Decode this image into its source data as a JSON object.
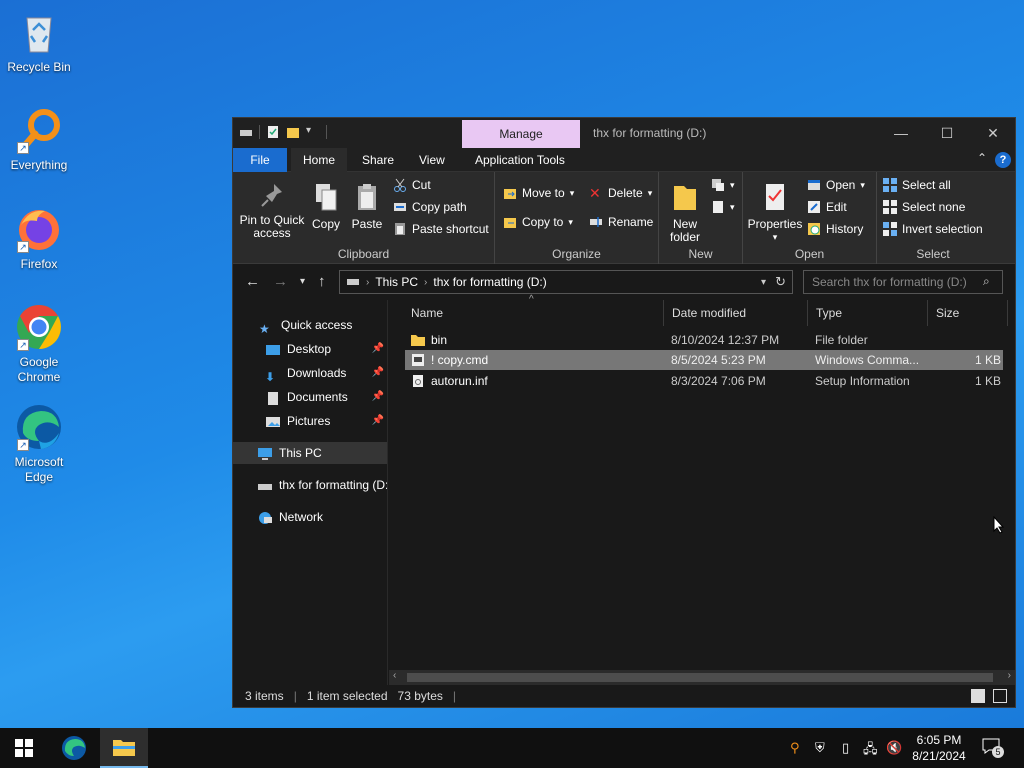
{
  "desktop": {
    "icons": [
      {
        "label": "Recycle Bin"
      },
      {
        "label": "Everything"
      },
      {
        "label": "Firefox"
      },
      {
        "label": "Google Chrome"
      },
      {
        "label": "Microsoft Edge"
      }
    ]
  },
  "window": {
    "manage_tab": "Manage",
    "title": "thx for formatting (D:)",
    "tabs": {
      "file": "File",
      "home": "Home",
      "share": "Share",
      "view": "View",
      "app_tools": "Application Tools"
    },
    "ribbon": {
      "clipboard": {
        "label": "Clipboard",
        "pin": "Pin to Quick access",
        "copy": "Copy",
        "paste": "Paste",
        "cut": "Cut",
        "copy_path": "Copy path",
        "paste_shortcut": "Paste shortcut"
      },
      "organize": {
        "label": "Organize",
        "move_to": "Move to",
        "copy_to": "Copy to",
        "delete": "Delete",
        "rename": "Rename"
      },
      "new": {
        "label": "New",
        "new_folder": "New folder"
      },
      "open": {
        "label": "Open",
        "properties": "Properties",
        "open": "Open",
        "edit": "Edit",
        "history": "History"
      },
      "select": {
        "label": "Select",
        "select_all": "Select all",
        "select_none": "Select none",
        "invert": "Invert selection"
      }
    },
    "address": {
      "crumb1": "This PC",
      "crumb2": "thx for formatting (D:)"
    },
    "search_placeholder": "Search thx for formatting (D:)",
    "nav": {
      "quick_access": "Quick access",
      "desktop": "Desktop",
      "downloads": "Downloads",
      "documents": "Documents",
      "pictures": "Pictures",
      "this_pc": "This PC",
      "drive": "thx for formatting (D:)",
      "network": "Network"
    },
    "columns": {
      "name": "Name",
      "date": "Date modified",
      "type": "Type",
      "size": "Size"
    },
    "files": [
      {
        "name": "bin",
        "date": "8/10/2024 12:37 PM",
        "type": "File folder",
        "size": ""
      },
      {
        "name": "! copy.cmd",
        "date": "8/5/2024 5:23 PM",
        "type": "Windows Comma...",
        "size": "1 KB"
      },
      {
        "name": "autorun.inf",
        "date": "8/3/2024 7:06 PM",
        "type": "Setup Information",
        "size": "1 KB"
      }
    ],
    "status": {
      "items": "3 items",
      "selected": "1 item selected",
      "bytes": "73 bytes"
    }
  },
  "taskbar": {
    "time": "6:05 PM",
    "date": "8/21/2024",
    "notifications": "5"
  },
  "colors": {
    "accent": "#1a6ccf",
    "manage": "#e9c8f3",
    "desktop": "#1f8be8"
  }
}
